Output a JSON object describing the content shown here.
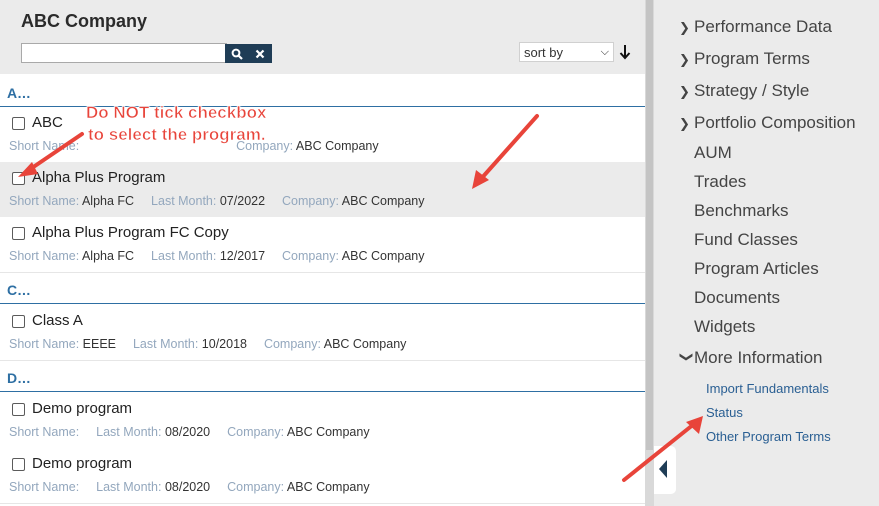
{
  "header": {
    "company_title": "ABC Company",
    "search_value": "",
    "sort_label": "sort by"
  },
  "groups": [
    {
      "letter": "A..."
    },
    {
      "letter": "C..."
    },
    {
      "letter": "D..."
    }
  ],
  "labels": {
    "short_name": "Short Name:",
    "last_month": "Last Month:",
    "company": "Company:"
  },
  "programs": [
    {
      "name": "ABC",
      "short_name": "",
      "last_month": "",
      "company": "ABC Company"
    },
    {
      "name": "Alpha Plus Program",
      "short_name": "Alpha FC",
      "last_month": "07/2022",
      "company": "ABC Company",
      "selected": true
    },
    {
      "name": "Alpha Plus Program FC Copy",
      "short_name": "Alpha FC",
      "last_month": "12/2017",
      "company": "ABC Company"
    },
    {
      "name": "Class A",
      "short_name": "EEEE",
      "last_month": "10/2018",
      "company": "ABC Company"
    },
    {
      "name": "Demo program",
      "short_name": "",
      "last_month": "08/2020",
      "company": "ABC Company"
    },
    {
      "name": "Demo program",
      "short_name": "",
      "last_month": "08/2020",
      "company": "ABC Company"
    }
  ],
  "sidebar": {
    "sections": [
      {
        "label": "Performance Data"
      },
      {
        "label": "Program Terms"
      },
      {
        "label": "Strategy / Style"
      },
      {
        "label": "Portfolio Composition"
      }
    ],
    "items": [
      {
        "label": "AUM"
      },
      {
        "label": "Trades"
      },
      {
        "label": "Benchmarks"
      },
      {
        "label": "Fund Classes"
      },
      {
        "label": "Program Articles"
      },
      {
        "label": "Documents"
      },
      {
        "label": "Widgets"
      }
    ],
    "more_info": {
      "label": "More Information",
      "links": [
        {
          "label": "Import Fundamentals"
        },
        {
          "label": "Status"
        },
        {
          "label": "Other Program Terms"
        }
      ]
    }
  },
  "annotation": {
    "line1": "Do NOT tick checkbox",
    "line2": "to select the program."
  },
  "colors": {
    "accent": "#2e6fa3",
    "header_bg": "#ebebeb",
    "search_buttons": "#1f3d56",
    "annotation": "#e8443a"
  }
}
